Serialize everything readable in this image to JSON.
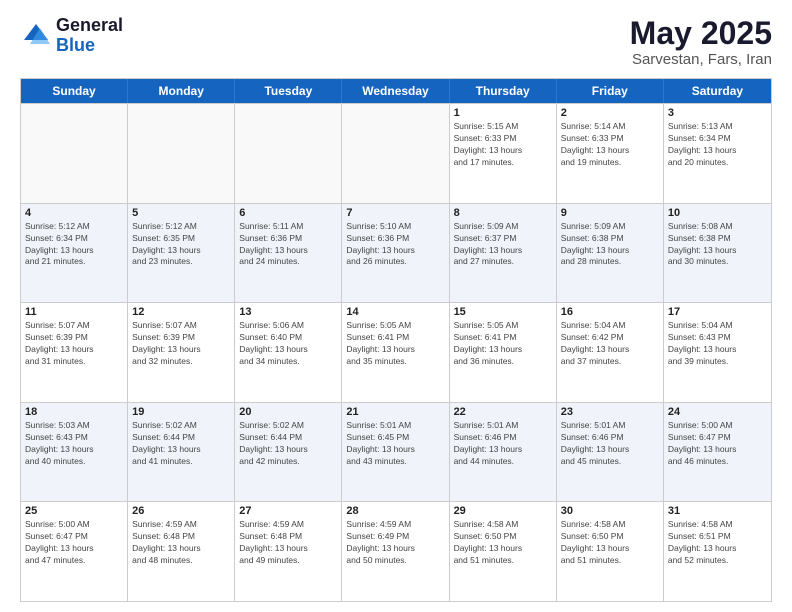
{
  "header": {
    "logo_general": "General",
    "logo_blue": "Blue",
    "title": "May 2025",
    "location": "Sarvestan, Fars, Iran"
  },
  "weekdays": [
    "Sunday",
    "Monday",
    "Tuesday",
    "Wednesday",
    "Thursday",
    "Friday",
    "Saturday"
  ],
  "rows": [
    [
      {
        "day": "",
        "info": "",
        "empty": true
      },
      {
        "day": "",
        "info": "",
        "empty": true
      },
      {
        "day": "",
        "info": "",
        "empty": true
      },
      {
        "day": "",
        "info": "",
        "empty": true
      },
      {
        "day": "1",
        "info": "Sunrise: 5:15 AM\nSunset: 6:33 PM\nDaylight: 13 hours\nand 17 minutes."
      },
      {
        "day": "2",
        "info": "Sunrise: 5:14 AM\nSunset: 6:33 PM\nDaylight: 13 hours\nand 19 minutes."
      },
      {
        "day": "3",
        "info": "Sunrise: 5:13 AM\nSunset: 6:34 PM\nDaylight: 13 hours\nand 20 minutes."
      }
    ],
    [
      {
        "day": "4",
        "info": "Sunrise: 5:12 AM\nSunset: 6:34 PM\nDaylight: 13 hours\nand 21 minutes."
      },
      {
        "day": "5",
        "info": "Sunrise: 5:12 AM\nSunset: 6:35 PM\nDaylight: 13 hours\nand 23 minutes."
      },
      {
        "day": "6",
        "info": "Sunrise: 5:11 AM\nSunset: 6:36 PM\nDaylight: 13 hours\nand 24 minutes."
      },
      {
        "day": "7",
        "info": "Sunrise: 5:10 AM\nSunset: 6:36 PM\nDaylight: 13 hours\nand 26 minutes."
      },
      {
        "day": "8",
        "info": "Sunrise: 5:09 AM\nSunset: 6:37 PM\nDaylight: 13 hours\nand 27 minutes."
      },
      {
        "day": "9",
        "info": "Sunrise: 5:09 AM\nSunset: 6:38 PM\nDaylight: 13 hours\nand 28 minutes."
      },
      {
        "day": "10",
        "info": "Sunrise: 5:08 AM\nSunset: 6:38 PM\nDaylight: 13 hours\nand 30 minutes."
      }
    ],
    [
      {
        "day": "11",
        "info": "Sunrise: 5:07 AM\nSunset: 6:39 PM\nDaylight: 13 hours\nand 31 minutes."
      },
      {
        "day": "12",
        "info": "Sunrise: 5:07 AM\nSunset: 6:39 PM\nDaylight: 13 hours\nand 32 minutes."
      },
      {
        "day": "13",
        "info": "Sunrise: 5:06 AM\nSunset: 6:40 PM\nDaylight: 13 hours\nand 34 minutes."
      },
      {
        "day": "14",
        "info": "Sunrise: 5:05 AM\nSunset: 6:41 PM\nDaylight: 13 hours\nand 35 minutes."
      },
      {
        "day": "15",
        "info": "Sunrise: 5:05 AM\nSunset: 6:41 PM\nDaylight: 13 hours\nand 36 minutes."
      },
      {
        "day": "16",
        "info": "Sunrise: 5:04 AM\nSunset: 6:42 PM\nDaylight: 13 hours\nand 37 minutes."
      },
      {
        "day": "17",
        "info": "Sunrise: 5:04 AM\nSunset: 6:43 PM\nDaylight: 13 hours\nand 39 minutes."
      }
    ],
    [
      {
        "day": "18",
        "info": "Sunrise: 5:03 AM\nSunset: 6:43 PM\nDaylight: 13 hours\nand 40 minutes."
      },
      {
        "day": "19",
        "info": "Sunrise: 5:02 AM\nSunset: 6:44 PM\nDaylight: 13 hours\nand 41 minutes."
      },
      {
        "day": "20",
        "info": "Sunrise: 5:02 AM\nSunset: 6:44 PM\nDaylight: 13 hours\nand 42 minutes."
      },
      {
        "day": "21",
        "info": "Sunrise: 5:01 AM\nSunset: 6:45 PM\nDaylight: 13 hours\nand 43 minutes."
      },
      {
        "day": "22",
        "info": "Sunrise: 5:01 AM\nSunset: 6:46 PM\nDaylight: 13 hours\nand 44 minutes."
      },
      {
        "day": "23",
        "info": "Sunrise: 5:01 AM\nSunset: 6:46 PM\nDaylight: 13 hours\nand 45 minutes."
      },
      {
        "day": "24",
        "info": "Sunrise: 5:00 AM\nSunset: 6:47 PM\nDaylight: 13 hours\nand 46 minutes."
      }
    ],
    [
      {
        "day": "25",
        "info": "Sunrise: 5:00 AM\nSunset: 6:47 PM\nDaylight: 13 hours\nand 47 minutes."
      },
      {
        "day": "26",
        "info": "Sunrise: 4:59 AM\nSunset: 6:48 PM\nDaylight: 13 hours\nand 48 minutes."
      },
      {
        "day": "27",
        "info": "Sunrise: 4:59 AM\nSunset: 6:48 PM\nDaylight: 13 hours\nand 49 minutes."
      },
      {
        "day": "28",
        "info": "Sunrise: 4:59 AM\nSunset: 6:49 PM\nDaylight: 13 hours\nand 50 minutes."
      },
      {
        "day": "29",
        "info": "Sunrise: 4:58 AM\nSunset: 6:50 PM\nDaylight: 13 hours\nand 51 minutes."
      },
      {
        "day": "30",
        "info": "Sunrise: 4:58 AM\nSunset: 6:50 PM\nDaylight: 13 hours\nand 51 minutes."
      },
      {
        "day": "31",
        "info": "Sunrise: 4:58 AM\nSunset: 6:51 PM\nDaylight: 13 hours\nand 52 minutes."
      }
    ]
  ]
}
